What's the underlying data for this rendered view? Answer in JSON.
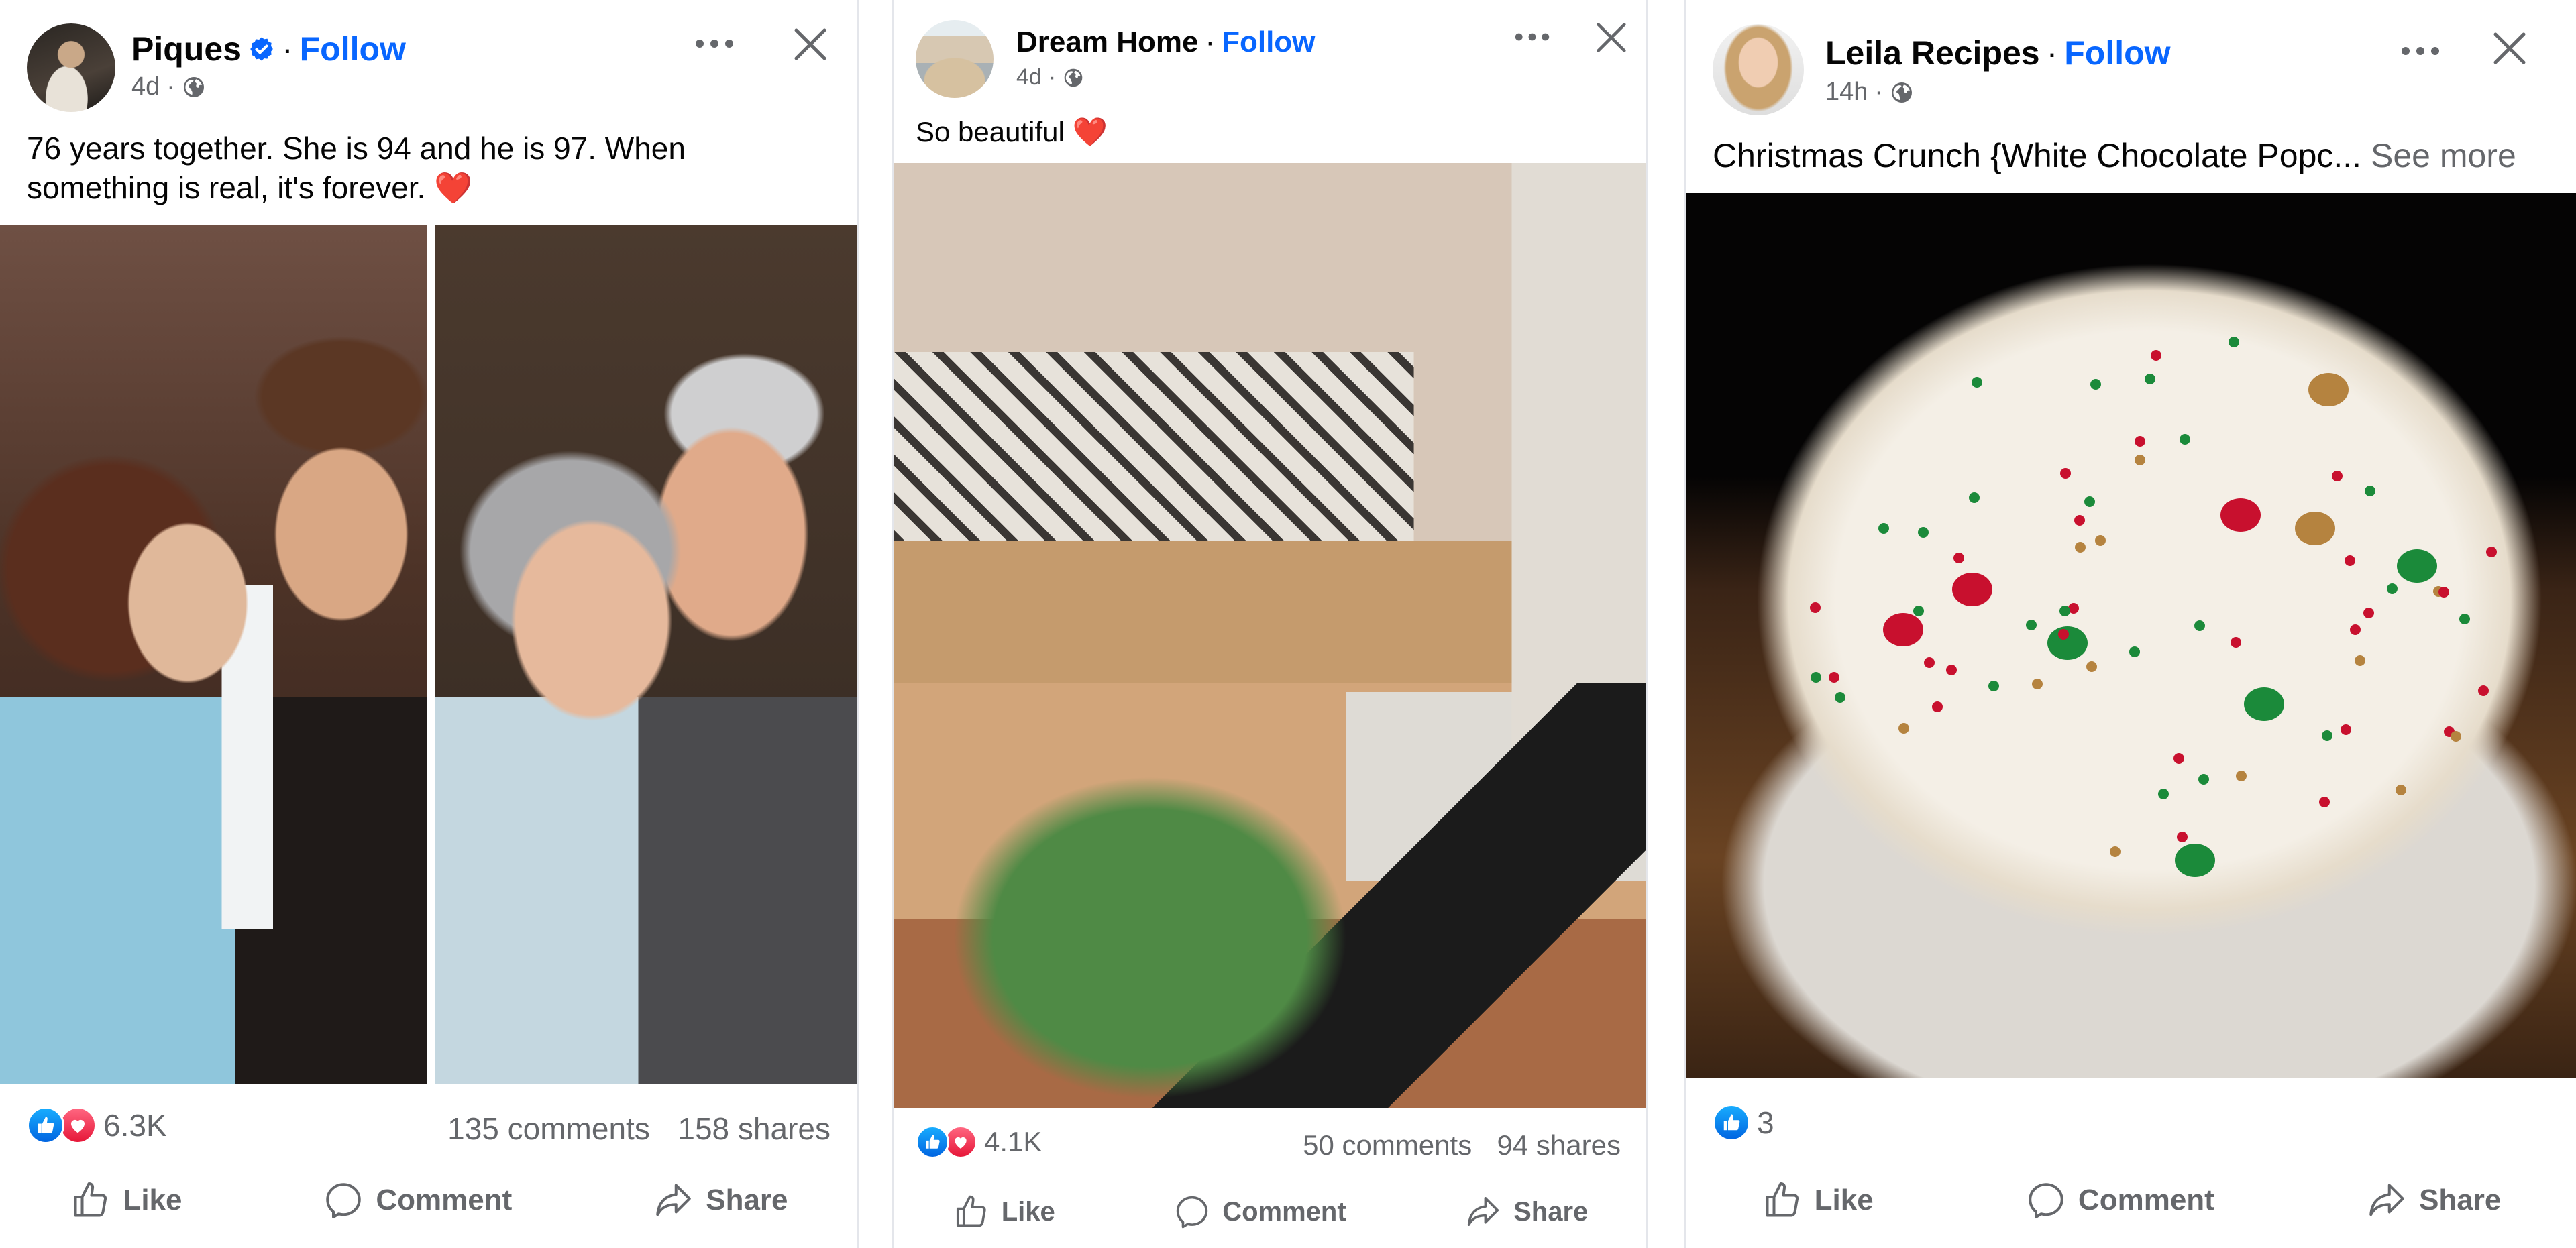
{
  "posts": [
    {
      "author": "Piques",
      "verified": true,
      "follow_label": "Follow",
      "separator": "·",
      "time": "4d",
      "audience_icon": "globe-icon",
      "caption": "76 years together. She is 94 and he is 97. When something is real, it's forever.",
      "caption_emoji": "❤️",
      "photo_alt": "Side-by-side photos: young couple at wedding, then same couple elderly",
      "reaction_types": [
        "like",
        "love"
      ],
      "reaction_count": "6.3K",
      "comments": "135 comments",
      "shares": "158 shares"
    },
    {
      "author": "Dream Home",
      "verified": false,
      "follow_label": "Follow",
      "separator": "·",
      "time": "4d",
      "audience_icon": "globe-icon",
      "caption": "So beautiful",
      "caption_emoji": "❤️",
      "photo_alt": "Kitchen with patterned tile backsplash, wooden countertop and a plant in a black sink",
      "reaction_types": [
        "like",
        "love"
      ],
      "reaction_count": "4.1K",
      "comments": "50 comments",
      "shares": "94 shares"
    },
    {
      "author": "Leila Recipes",
      "verified": false,
      "follow_label": "Follow",
      "separator": "·",
      "time": "14h",
      "audience_icon": "globe-icon",
      "caption": "Christmas Crunch {White Chocolate Popc...",
      "see_more": "See more",
      "photo_alt": "Bowl of white chocolate popcorn with red and green candies and pretzels",
      "reaction_types": [
        "like"
      ],
      "reaction_count": "3"
    }
  ],
  "actions": {
    "like": "Like",
    "comment": "Comment",
    "share": "Share"
  },
  "colors": {
    "accent": "#0866ff",
    "secondary_text": "#65676b",
    "like_blue": "#1877f2",
    "love_red": "#f33e58"
  }
}
